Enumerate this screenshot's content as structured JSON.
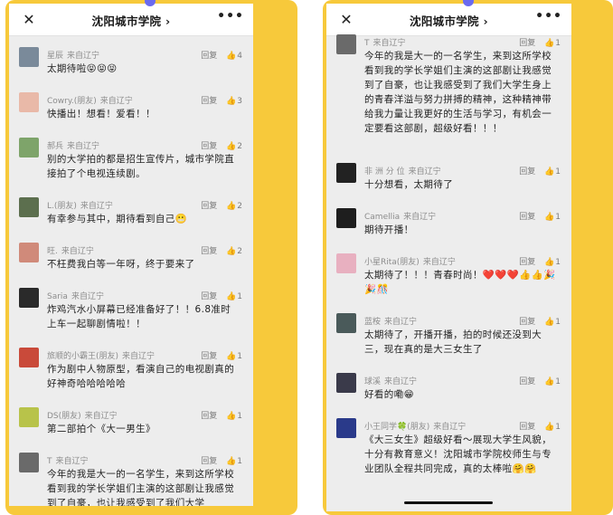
{
  "left": {
    "title": "沈阳城市学院 ›",
    "close_icon": "close-icon",
    "more_label": "•••",
    "comments": [
      {
        "name": "星辰",
        "loc": "来自辽宁",
        "text": "太期待啦😝😝😝",
        "reply": "回复",
        "likes": "4",
        "avatar_color": "#7a8a9a"
      },
      {
        "name": "Cowry.(朋友)",
        "loc": "来自辽宁",
        "text": "快播出！想看！爱看！！",
        "reply": "回复",
        "likes": "3",
        "avatar_color": "#e9b9a8"
      },
      {
        "name": "郝兵",
        "loc": "来自辽宁",
        "text": "别的大学拍的都是招生宣传片，城市学院直接拍了个电视连续剧。",
        "reply": "回复",
        "likes": "2",
        "avatar_color": "#7ea46a"
      },
      {
        "name": "L.(朋友)",
        "loc": "来自辽宁",
        "text": "有幸参与其中，期待看到自己😬",
        "reply": "回复",
        "likes": "2",
        "avatar_color": "#5c6f4e"
      },
      {
        "name": "旺.",
        "loc": "来自辽宁",
        "text": "不枉费我白等一年呀，终于要来了",
        "reply": "回复",
        "likes": "2",
        "avatar_color": "#d08a7a"
      },
      {
        "name": "Saria",
        "loc": "来自辽宁",
        "text": "炸鸡汽水小屏幕已经准备好了！！6.8准时上车一起聊剧情啦！！",
        "reply": "回复",
        "likes": "1",
        "avatar_color": "#2a2a2a"
      },
      {
        "name": "旅顺的小霸王(朋友)",
        "loc": "来自辽宁",
        "text": "作为剧中人物原型，看演自己的电视剧真的好神奇哈哈哈哈哈",
        "reply": "回复",
        "likes": "1",
        "avatar_color": "#c94a3a"
      },
      {
        "name": "DS(朋友)",
        "loc": "来自辽宁",
        "text": "第二部拍个《大一男生》",
        "reply": "回复",
        "likes": "1",
        "avatar_color": "#b8c34a"
      },
      {
        "name": "T",
        "loc": "来自辽宁",
        "text": "今年的我是大一的一名学生，来到这所学校看到我的学长学姐们主演的这部剧让我感觉到了自豪，也让我感受到了我们大学",
        "reply": "回复",
        "likes": "1",
        "avatar_color": "#6a6a6a"
      }
    ]
  },
  "right": {
    "title": "沈阳城市学院 ›",
    "close_icon": "close-icon",
    "more_label": "•••",
    "comments": [
      {
        "name": "T",
        "loc": "来自辽宁",
        "text": "今年的我是大一的一名学生，来到这所学校看到我的学长学姐们主演的这部剧让我感觉到了自豪，也让我感受到了我们大学生身上的青春洋溢与努力拼搏的精神，这种精神带给我力量让我更好的生活与学习，有机会一定要看这部剧，超级好看！！！",
        "reply": "回复",
        "likes": "1",
        "avatar_color": "#6a6a6a"
      },
      {
        "name": "非 洲 分 位",
        "loc": "来自辽宁",
        "text": "十分想看，太期待了",
        "reply": "回复",
        "likes": "1",
        "avatar_color": "#222222"
      },
      {
        "name": "Camellia",
        "loc": "来自辽宁",
        "text": "期待开播！",
        "reply": "回复",
        "likes": "1",
        "avatar_color": "#1e1e1e"
      },
      {
        "name": "小星Rita(朋友)",
        "loc": "来自辽宁",
        "text": "太期待了！！！青春时尚！❤️❤️❤️👍👍🎉🎉🎊",
        "reply": "回复",
        "likes": "1",
        "avatar_color": "#e8b0c0"
      },
      {
        "name": "蓝桉",
        "loc": "来自辽宁",
        "text": "太期待了，开播开播，拍的时候还没到大三，现在真的是大三女生了",
        "reply": "回复",
        "likes": "1",
        "avatar_color": "#4a5a5a"
      },
      {
        "name": "球溪",
        "loc": "来自辽宁",
        "text": "好看的嘞😁",
        "reply": "回复",
        "likes": "1",
        "avatar_color": "#3a3a4a"
      },
      {
        "name": "小王同学🍀(朋友)",
        "loc": "来自辽宁",
        "text": "《大三女生》超级好看～展现大学生风貌，十分有教育意义！沈阳城市学院校师生与专业团队全程共同完成，真的太棒啦🤗🤗",
        "reply": "回复",
        "likes": "1",
        "avatar_color": "#2a3a8a"
      }
    ]
  }
}
